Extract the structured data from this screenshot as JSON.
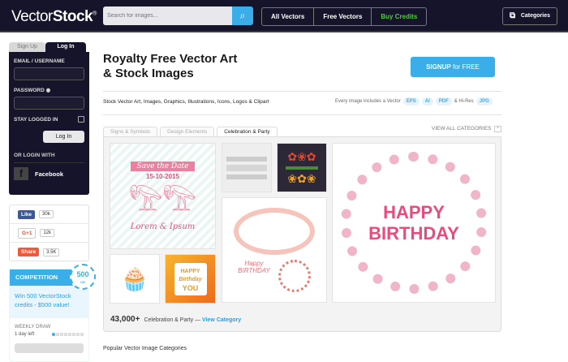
{
  "header": {
    "logo_light": "Vector",
    "logo_bold": "Stock",
    "logo_mark": "®",
    "search_placeholder": "Search for images...",
    "nav": [
      "All Vectors",
      "Free Vectors",
      "Buy Credits"
    ],
    "categories": "Categories"
  },
  "login": {
    "tabs": [
      "Sign Up",
      "Log In"
    ],
    "email_label": "EMAIL / USERNAME",
    "password_label": "PASSWORD",
    "stay": "STAY LOGGED IN",
    "button": "Log In",
    "or": "OR LOGIN WITH",
    "facebook": "Facebook"
  },
  "social": [
    {
      "label": "Like",
      "count": "30k",
      "color": "#3b5998"
    },
    {
      "label": "G+1",
      "count": "12k",
      "color": "#ffffff"
    },
    {
      "label": "Share",
      "count": "3.5K",
      "color": "#ee5a3a"
    }
  ],
  "competition": {
    "title": "COMPETITION",
    "badge": "500",
    "badge_sub": "CR",
    "text": "Win 500 VectorStock credits - $500 value!",
    "weekly": "WEEKLY DRAW",
    "left": "1 day left",
    "progress": 0.1
  },
  "main": {
    "title1": "Royalty Free Vector Art",
    "title2": "& Stock Images",
    "signup": "SIGNUP",
    "signup_rest": "for FREE",
    "subtitle": "Stock Vector Art, Images, Graphics, Illustrations, Icons, Logos & Clipart",
    "includes": "Every image includes a Vector",
    "formats": [
      "EPS",
      "AI",
      "PDF"
    ],
    "hires": "& Hi-Res",
    "jpg": "JPG"
  },
  "tabs": [
    "Signs & Symbols",
    "Design Elements",
    "Celebration & Party"
  ],
  "view_all": "VIEW ALL CATEGORIES",
  "images": {
    "save": "Save the Date",
    "date": "15-10-2015",
    "lorem": "Lorem & Ipsum",
    "happy": "HAPPY",
    "birthday": "BIRTHDAY",
    "you": "YOU",
    "bday_script": "Birthday"
  },
  "footer": {
    "count": "43,000+",
    "category": "Celebration & Party —",
    "link": "View Category"
  },
  "popular": "Popular Vector Image Categories"
}
